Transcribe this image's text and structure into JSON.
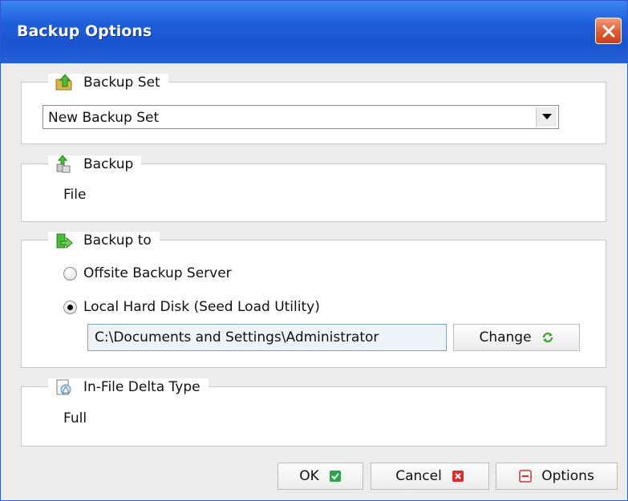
{
  "window": {
    "title": "Backup Options",
    "close_icon": "close-icon"
  },
  "backup_set": {
    "heading": "Backup Set",
    "icon": "folder-up-icon",
    "selected": "New Backup Set"
  },
  "backup": {
    "heading": "Backup",
    "icon": "backup-arrow-icon",
    "value": "File"
  },
  "backup_to": {
    "heading": "Backup to",
    "icon": "export-arrow-icon",
    "option_offsite": "Offsite Backup Server",
    "option_local": "Local Hard Disk (Seed Load Utility)",
    "selected_option": "Local Hard Disk (Seed Load Utility)",
    "path": "C:\\Documents and Settings\\Administrator",
    "change_label": "Change",
    "change_icon": "refresh-icon"
  },
  "delta": {
    "heading": "In-File Delta Type",
    "icon": "delta-icon",
    "value": "Full"
  },
  "footer": {
    "ok_label": "OK",
    "ok_icon": "check-icon",
    "cancel_label": "Cancel",
    "cancel_icon": "x-icon",
    "options_label": "Options",
    "options_icon": "minus-icon"
  },
  "colors": {
    "titlebar": "#1f5fdc",
    "ok_green": "#2ea44f",
    "cancel_red": "#d92c2c"
  }
}
